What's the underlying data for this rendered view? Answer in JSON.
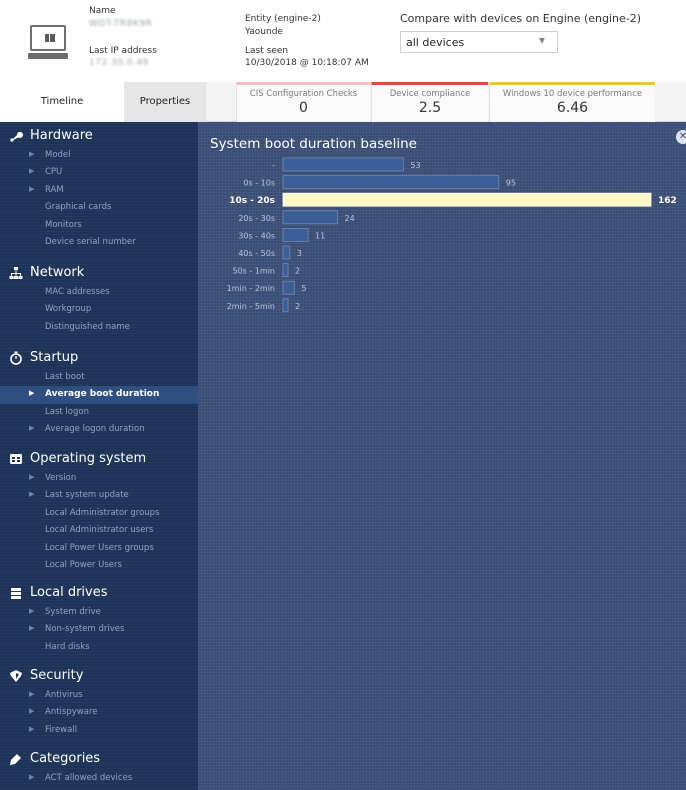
{
  "header": {
    "name_label": "Name",
    "name_value": "WDT-TR8K9R",
    "last_ip_label": "Last IP address",
    "last_ip_value": "172.30.0.49",
    "entity_label": "Entity (engine-2)",
    "entity_value": "Yaounde",
    "last_seen_label": "Last seen",
    "last_seen_value": "10/30/2018 @ 10:18:07 AM",
    "compare_label": "Compare with devices on Engine (engine-2)",
    "compare_value": "all devices"
  },
  "tabs": {
    "timeline": "Timeline",
    "properties": "Properties"
  },
  "scores": [
    {
      "title": "CIS Configuration Checks",
      "value": "0",
      "color": "#f0c0c0"
    },
    {
      "title": "Device compliance",
      "value": "2.5",
      "color": "#d84a3a"
    },
    {
      "title": "Windows 10 device performance",
      "value": "6.46",
      "color": "#e8c63a"
    }
  ],
  "sidebar": {
    "sections": [
      {
        "title": "Hardware",
        "icon": "wrench-icon",
        "items": [
          {
            "label": "Model",
            "chevron": true
          },
          {
            "label": "CPU",
            "chevron": true
          },
          {
            "label": "RAM",
            "chevron": true
          },
          {
            "label": "Graphical cards",
            "chevron": false
          },
          {
            "label": "Monitors",
            "chevron": false
          },
          {
            "label": "Device serial number",
            "chevron": false
          }
        ]
      },
      {
        "title": "Network",
        "icon": "network-icon",
        "items": [
          {
            "label": "MAC addresses",
            "chevron": false
          },
          {
            "label": "Workgroup",
            "chevron": false
          },
          {
            "label": "Distinguished name",
            "chevron": false
          }
        ]
      },
      {
        "title": "Startup",
        "icon": "stopwatch-icon",
        "items": [
          {
            "label": "Last boot",
            "chevron": false
          },
          {
            "label": "Average boot duration",
            "chevron": true,
            "active": true
          },
          {
            "label": "Last logon",
            "chevron": false
          },
          {
            "label": "Average logon duration",
            "chevron": true
          }
        ]
      },
      {
        "title": "Operating system",
        "icon": "os-window-icon",
        "items": [
          {
            "label": "Version",
            "chevron": true
          },
          {
            "label": "Last system update",
            "chevron": true
          },
          {
            "label": "Local Administrator groups",
            "chevron": false
          },
          {
            "label": "Local Administrator users",
            "chevron": false
          },
          {
            "label": "Local Power Users groups",
            "chevron": false
          },
          {
            "label": "Local Power Users",
            "chevron": false
          }
        ]
      },
      {
        "title": "Local drives",
        "icon": "drive-icon",
        "items": [
          {
            "label": "System drive",
            "chevron": true
          },
          {
            "label": "Non-system drives",
            "chevron": true
          },
          {
            "label": "Hard disks",
            "chevron": false
          }
        ]
      },
      {
        "title": "Security",
        "icon": "shield-icon",
        "items": [
          {
            "label": "Antivirus",
            "chevron": true
          },
          {
            "label": "Antispyware",
            "chevron": true
          },
          {
            "label": "Firewall",
            "chevron": true
          }
        ]
      },
      {
        "title": "Categories",
        "icon": "tag-icon",
        "items": [
          {
            "label": "ACT allowed devices",
            "chevron": true
          }
        ]
      }
    ]
  },
  "colors": {
    "sidebar_bg": "#1d3458",
    "panel_bg": "#3a4d74",
    "bar": "#3d5d96",
    "bar_highlight": "#fbf7c6"
  },
  "chart_data": {
    "type": "bar",
    "orientation": "horizontal",
    "title": "System boot duration baseline",
    "categories": [
      "-",
      "0s - 10s",
      "10s - 20s",
      "20s - 30s",
      "30s - 40s",
      "40s - 50s",
      "50s - 1min",
      "1min - 2min",
      "2min - 5min"
    ],
    "values": [
      53,
      95,
      162,
      24,
      11,
      3,
      2,
      5,
      2
    ],
    "highlighted_category": "10s - 20s",
    "xlim": [
      0,
      162
    ]
  }
}
